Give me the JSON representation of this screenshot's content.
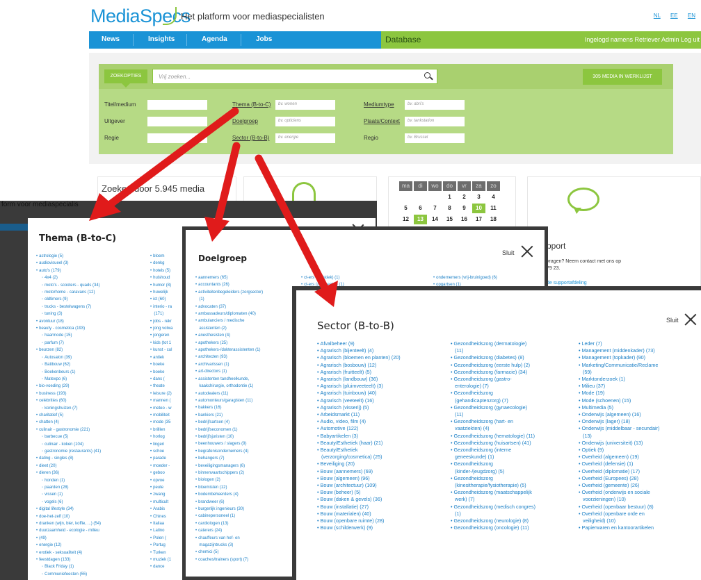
{
  "header": {
    "logo": "MediaSpecs",
    "tagline": "Het platform voor mediaspecialisten",
    "languages": [
      "NL",
      "EE",
      "EN"
    ]
  },
  "nav": {
    "items": [
      "News",
      "Insights",
      "Agenda",
      "Jobs"
    ],
    "database": "Database",
    "login": "Ingelogd namens Retriever Admin   Log uit"
  },
  "search": {
    "button": "ZOEKOPTIES",
    "placeholder": "Vrij zoeken...",
    "werklijst": "305 MEDIA IN WERKLIJST",
    "fields": {
      "titel": "Titel/medium",
      "uitgever": "Uitgever",
      "regie": "Regie",
      "thema": "Thema (B-to-C)",
      "thema_ph": "bv. wonen",
      "doelgroep": "Doelgroep",
      "doelgroep_ph": "bv. opticiens",
      "sector": "Sector (B-to-B)",
      "sector_ph": "bv. energie",
      "mediumtype": "Mediumtype",
      "mediumtype_ph": "bv. abri's",
      "plaats": "Plaats/Context",
      "plaats_ph": "bv. tankstation",
      "regio": "Regio",
      "regio_ph": "bv. Brussel"
    }
  },
  "content": {
    "zoeken": "Zoeken door 5.945 media",
    "support_title": "pport",
    "support_text": "vragen? Neem contact met ons op\n79 23.",
    "support_link": "de supportafdeling",
    "backdrop_text": "form voor mediaspecialis"
  },
  "calendar": {
    "days": [
      "ma",
      "di",
      "wo",
      "do",
      "vr",
      "za",
      "zo"
    ],
    "row1": [
      "",
      "",
      "",
      "1",
      "2",
      "3",
      "4"
    ],
    "row2": [
      "5",
      "6",
      "7",
      "8",
      "9",
      "10",
      "11"
    ],
    "row3": [
      "12",
      "13",
      "14",
      "15",
      "16",
      "17",
      "18"
    ]
  },
  "thema": {
    "title": "Thema (B-to-C)",
    "col1": [
      [
        "astrologie (5)",
        0
      ],
      [
        "audiovisueel (3)",
        0
      ],
      [
        "auto's (179)",
        0
      ],
      [
        "4x4 (2)",
        1
      ],
      [
        "moto's - scooters - quads (34)",
        1
      ],
      [
        "motorhome - caravans (12)",
        1
      ],
      [
        "oldtimers (9)",
        1
      ],
      [
        "trucks - bestelwagens (7)",
        1
      ],
      [
        "tuning (3)",
        1
      ],
      [
        "avontuur (18)",
        0
      ],
      [
        "beauty - cosmetica (193)",
        0
      ],
      [
        "haarmode (15)",
        1
      ],
      [
        "parfum (7)",
        1
      ],
      [
        "beurzen (82)",
        0
      ],
      [
        "Autosalon (39)",
        1
      ],
      [
        "Batibouw (62)",
        1
      ],
      [
        "Boekenbeurs (1)",
        1
      ],
      [
        "Matexpo (6)",
        1
      ],
      [
        "bio-voeding (29)",
        0
      ],
      [
        "business (193)",
        0
      ],
      [
        "celebrities (60)",
        0
      ],
      [
        "koningshuizen (7)",
        1
      ],
      [
        "charitatief (5)",
        0
      ],
      [
        "chatten (4)",
        0
      ],
      [
        "culinair - gastronomie (221)",
        0
      ],
      [
        "barbecue (5)",
        1
      ],
      [
        "culinair - koken (104)",
        1
      ],
      [
        "gastronomie (restaurants) (41)",
        1
      ],
      [
        "dating - singles (8)",
        0
      ],
      [
        "dieet (20)",
        0
      ],
      [
        "dieren (36)",
        0
      ],
      [
        "honden (1)",
        1
      ],
      [
        "paarden (28)",
        1
      ],
      [
        "vissen (1)",
        1
      ],
      [
        "vogels (6)",
        1
      ],
      [
        "digital lifestyle (34)",
        0
      ],
      [
        "doe-het-zelf (10)",
        0
      ],
      [
        "dranken (wijn, bier, koffie, ...) (54)",
        0
      ],
      [
        "duurzaamheid - ecologie - milieu",
        0
      ],
      [
        "(49)",
        0
      ],
      [
        "energie (12)",
        0
      ],
      [
        "erotiek - seksualiteit (4)",
        0
      ],
      [
        "feestdagen (133)",
        0
      ],
      [
        "Black Friday (1)",
        1
      ],
      [
        "Communiefeesten (55)",
        1
      ]
    ],
    "col2": [
      "bloem",
      "denkg",
      "hotels (5)",
      "huishoud",
      "humor (8)",
      "huwelijk",
      "ict (60)",
      "interio - ra",
      "(171)",
      "jobs - rekr",
      "jong volwa",
      "jongeren",
      "kids (tot 1",
      "kunst - cul",
      "antiek",
      "boeke",
      "boeke",
      "dans (",
      "theate",
      "leisure (2)",
      "mannen (",
      "meteo - w",
      "mobiliteit",
      "mode (35",
      "brilllen",
      "horlog",
      "lingeri",
      "schoe",
      "parade",
      "moeder -",
      "geboo",
      "opvoe",
      "peute",
      "zwang",
      "multicult",
      "Arabis",
      "Chines",
      "Italiaa",
      "Latino",
      "Polen (",
      "Portug",
      "Turken",
      "muziek (1",
      "dance"
    ]
  },
  "doelgroep": {
    "title": "Doelgroep",
    "sluit": "Sluit",
    "col1": [
      "aannemers (65)",
      "accountants (26)",
      "activiteitenbegeleiders (zorgsector)",
      "(1)",
      "advocaten (37)",
      "ambassadeurs/diplomaten (40)",
      "ambulanciers / medische",
      "assistenten (2)",
      "anesthesisten (4)",
      "apothekers (25)",
      "apothekers-/dokterassistenten (1)",
      "architecten (93)",
      "archivarissen (1)",
      "art-directors (1)",
      "assistenten tandheelkunde,",
      "kaakchirurgie, orthodontie (1)",
      "autodealers (11)",
      "automonteurs/garagisten (11)",
      "bakkers (16)",
      "bankiers (21)",
      "bedrijfsartsen (4)",
      "bedrijfseconomen (1)",
      "bedrijfsjuristen (10)",
      "beenhouwers / slagers (9)",
      "begrafenisondernemers (4)",
      "behangers (7)",
      "beveiligingsmanagers (6)",
      "binnenvaartschippers (2)",
      "biologen (2)",
      "bloemisten (12)",
      "bodembeheerders (4)",
      "brandweer (6)",
      "burgerlijk ingenieurs (30)",
      "cabinepersoneel (1)",
      "cardiologen (13)",
      "caterers (24)",
      "chauffeurs van hef- en",
      "magazijntrucks (3)",
      "chemici (5)",
      "coaches/trainers (sport) (7)"
    ],
    "col2": [
      "ct-ers (logistiek) (1)",
      "ct-ers (zorgsector) (1)"
    ],
    "col3": [
      "ondernemers (vrij-bruinigoed) (6)",
      "opgartsen (1)"
    ]
  },
  "sector": {
    "title": "Sector (B-to-B)",
    "sluit": "Sluit",
    "col1": [
      "Afvalbeheer (9)",
      "Agrarisch (bijenteelt) (4)",
      "Agrarisch (bloemen en planten) (20)",
      "Agrarisch (bosbouw) (12)",
      "Agrarisch (fruitteelt) (5)",
      "Agrarisch (landbouw) (36)",
      "Agrarisch (pluimveeteelt) (3)",
      "Agrarisch (tuinbouw) (40)",
      "Agrarisch (veeteelt) (16)",
      "Agrarisch (visserij) (5)",
      "Arbeidsmarkt (11)",
      "Audio, video, film (4)",
      "Automotive (122)",
      "Babyartikelen (3)",
      "Beauty/Esthetiek (haar) (21)",
      "Beauty/Esthetiek",
      "(verzorging/cosmetica) (25)",
      "Beveiliging (20)",
      "Bouw (aannemers) (69)",
      "Bouw (algemeen) (96)",
      "Bouw (architectuur) (109)",
      "Bouw (beheer) (5)",
      "Bouw (daken & gevels) (36)",
      "Bouw (installatie) (27)",
      "Bouw (materialen) (40)",
      "Bouw (openbare ruimte) (28)",
      "Bouw (schilderwerk) (9)"
    ],
    "col2": [
      "Gezondheidszorg (dermatologie)",
      "(11)",
      "Gezondheidszorg (diabetes) (8)",
      "Gezondheidszorg (eerste hulp) (2)",
      "Gezondheidszorg (farmacie) (34)",
      "Gezondheidszorg (gastro-",
      "enterologie) (7)",
      "Gezondheidszorg",
      "(gehandicaptenzorg) (7)",
      "Gezondheidszorg (gynaecologie)",
      "(11)",
      "Gezondheidszorg (hart- en",
      "vaatziekten) (4)",
      "Gezondheidszorg (hematologie) (11)",
      "Gezondheidszorg (huisartsen) (41)",
      "Gezondheidszorg (interne",
      "geneeskunde) (1)",
      "Gezondheidszorg",
      "(kinder-/jeugdzorg) (5)",
      "Gezondheidszorg",
      "(kinesitherapie/fysiotherapie) (5)",
      "Gezondheidszorg (maatschappelijk",
      "werk) (7)",
      "Gezondheidszorg (medisch congres)",
      "(1)",
      "Gezondheidszorg (neurologie) (8)",
      "Gezondheidszorg (oncologie) (11)"
    ],
    "col3": [
      "Leder (7)",
      "Management (middenkader) (73)",
      "Management (topkader) (90)",
      "Marketing/Communicatie/Reclame",
      "(59)",
      "Marktonderzoek (1)",
      "Milieu (37)",
      "Mode (19)",
      "Mode (schoenen) (15)",
      "Multimedia (5)",
      "Onderwijs (algemeen) (16)",
      "Onderwijs (lager) (18)",
      "Onderwijs (middelbaar - secundair)",
      "(13)",
      "Onderwijs (universiteit) (13)",
      "Optiek (9)",
      "Overheid (algemeen) (19)",
      "Overheid (defensie) (1)",
      "Overheid (diplomatie) (17)",
      "Overheid (Europees) (28)",
      "Overheid (gemeente) (26)",
      "Overheid (onderwijs en sociale",
      "voorzieningen) (10)",
      "Overheid (openbaar bestuur) (8)",
      "Overheid (openbare orde en",
      "veiligheid) (10)",
      "Papierwaren en kantoorartikelen"
    ]
  }
}
